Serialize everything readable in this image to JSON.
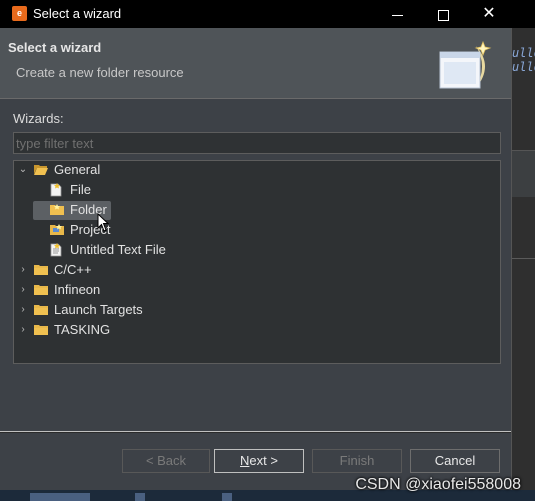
{
  "window": {
    "title": "Select a wizard",
    "icon": "eclipse-app-icon"
  },
  "header": {
    "title": "Select a wizard",
    "description": "Create a new folder resource"
  },
  "filter": {
    "label": "Wizards:",
    "placeholder": "type filter text",
    "value": ""
  },
  "tree": [
    {
      "label": "General",
      "expanded": true,
      "icon": "folder-open-icon"
    },
    {
      "label": "File",
      "icon": "file-icon",
      "child": true
    },
    {
      "label": "Folder",
      "icon": "folder-icon",
      "child": true,
      "selected": true
    },
    {
      "label": "Project",
      "icon": "project-icon",
      "child": true
    },
    {
      "label": "Untitled Text File",
      "icon": "text-file-icon",
      "child": true
    },
    {
      "label": "C/C++",
      "expanded": false,
      "icon": "folder-icon"
    },
    {
      "label": "Infineon",
      "expanded": false,
      "icon": "folder-icon"
    },
    {
      "label": "Launch Targets",
      "expanded": false,
      "icon": "folder-icon"
    },
    {
      "label": "TASKING",
      "expanded": false,
      "icon": "folder-icon"
    }
  ],
  "buttons": {
    "back": "< Back",
    "next": "Next >",
    "finish": "Finish",
    "cancel": "Cancel"
  },
  "background": {
    "code_text": "ullo",
    "watermark": "CSDN @xiaofei558008"
  },
  "colors": {
    "titlebar": "#000000",
    "dialog": "#3d4147",
    "header": "#4f5458",
    "folder": "#e8b84a"
  }
}
